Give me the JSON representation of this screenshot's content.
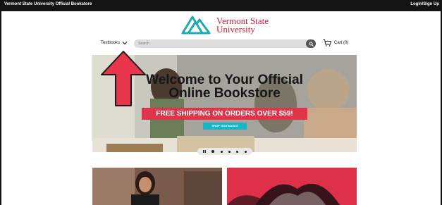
{
  "topbar": {
    "store_name": "Vermont State University Official Bookstore",
    "login_label": "Login/Sign Up"
  },
  "logo": {
    "line1": "Vermont State",
    "line2": "University",
    "color": "#c0243a",
    "mark_color": "#1fa9b0"
  },
  "nav": {
    "textbooks_label": "Textbooks",
    "search_placeholder": "Search",
    "cart_label": "Cart (0)"
  },
  "hero": {
    "title_line1": "Welcome to Your Official",
    "title_line2": "Online Bookstore",
    "promo": "FREE SHIPPING ON ORDERS OVER $59!",
    "cta": "SHOP TEXTBOOKS",
    "slide_count": 5,
    "active_slide": 1
  },
  "colors": {
    "accent": "#e0344a",
    "cta": "#19b4c6",
    "arrow": "#e8354c"
  }
}
